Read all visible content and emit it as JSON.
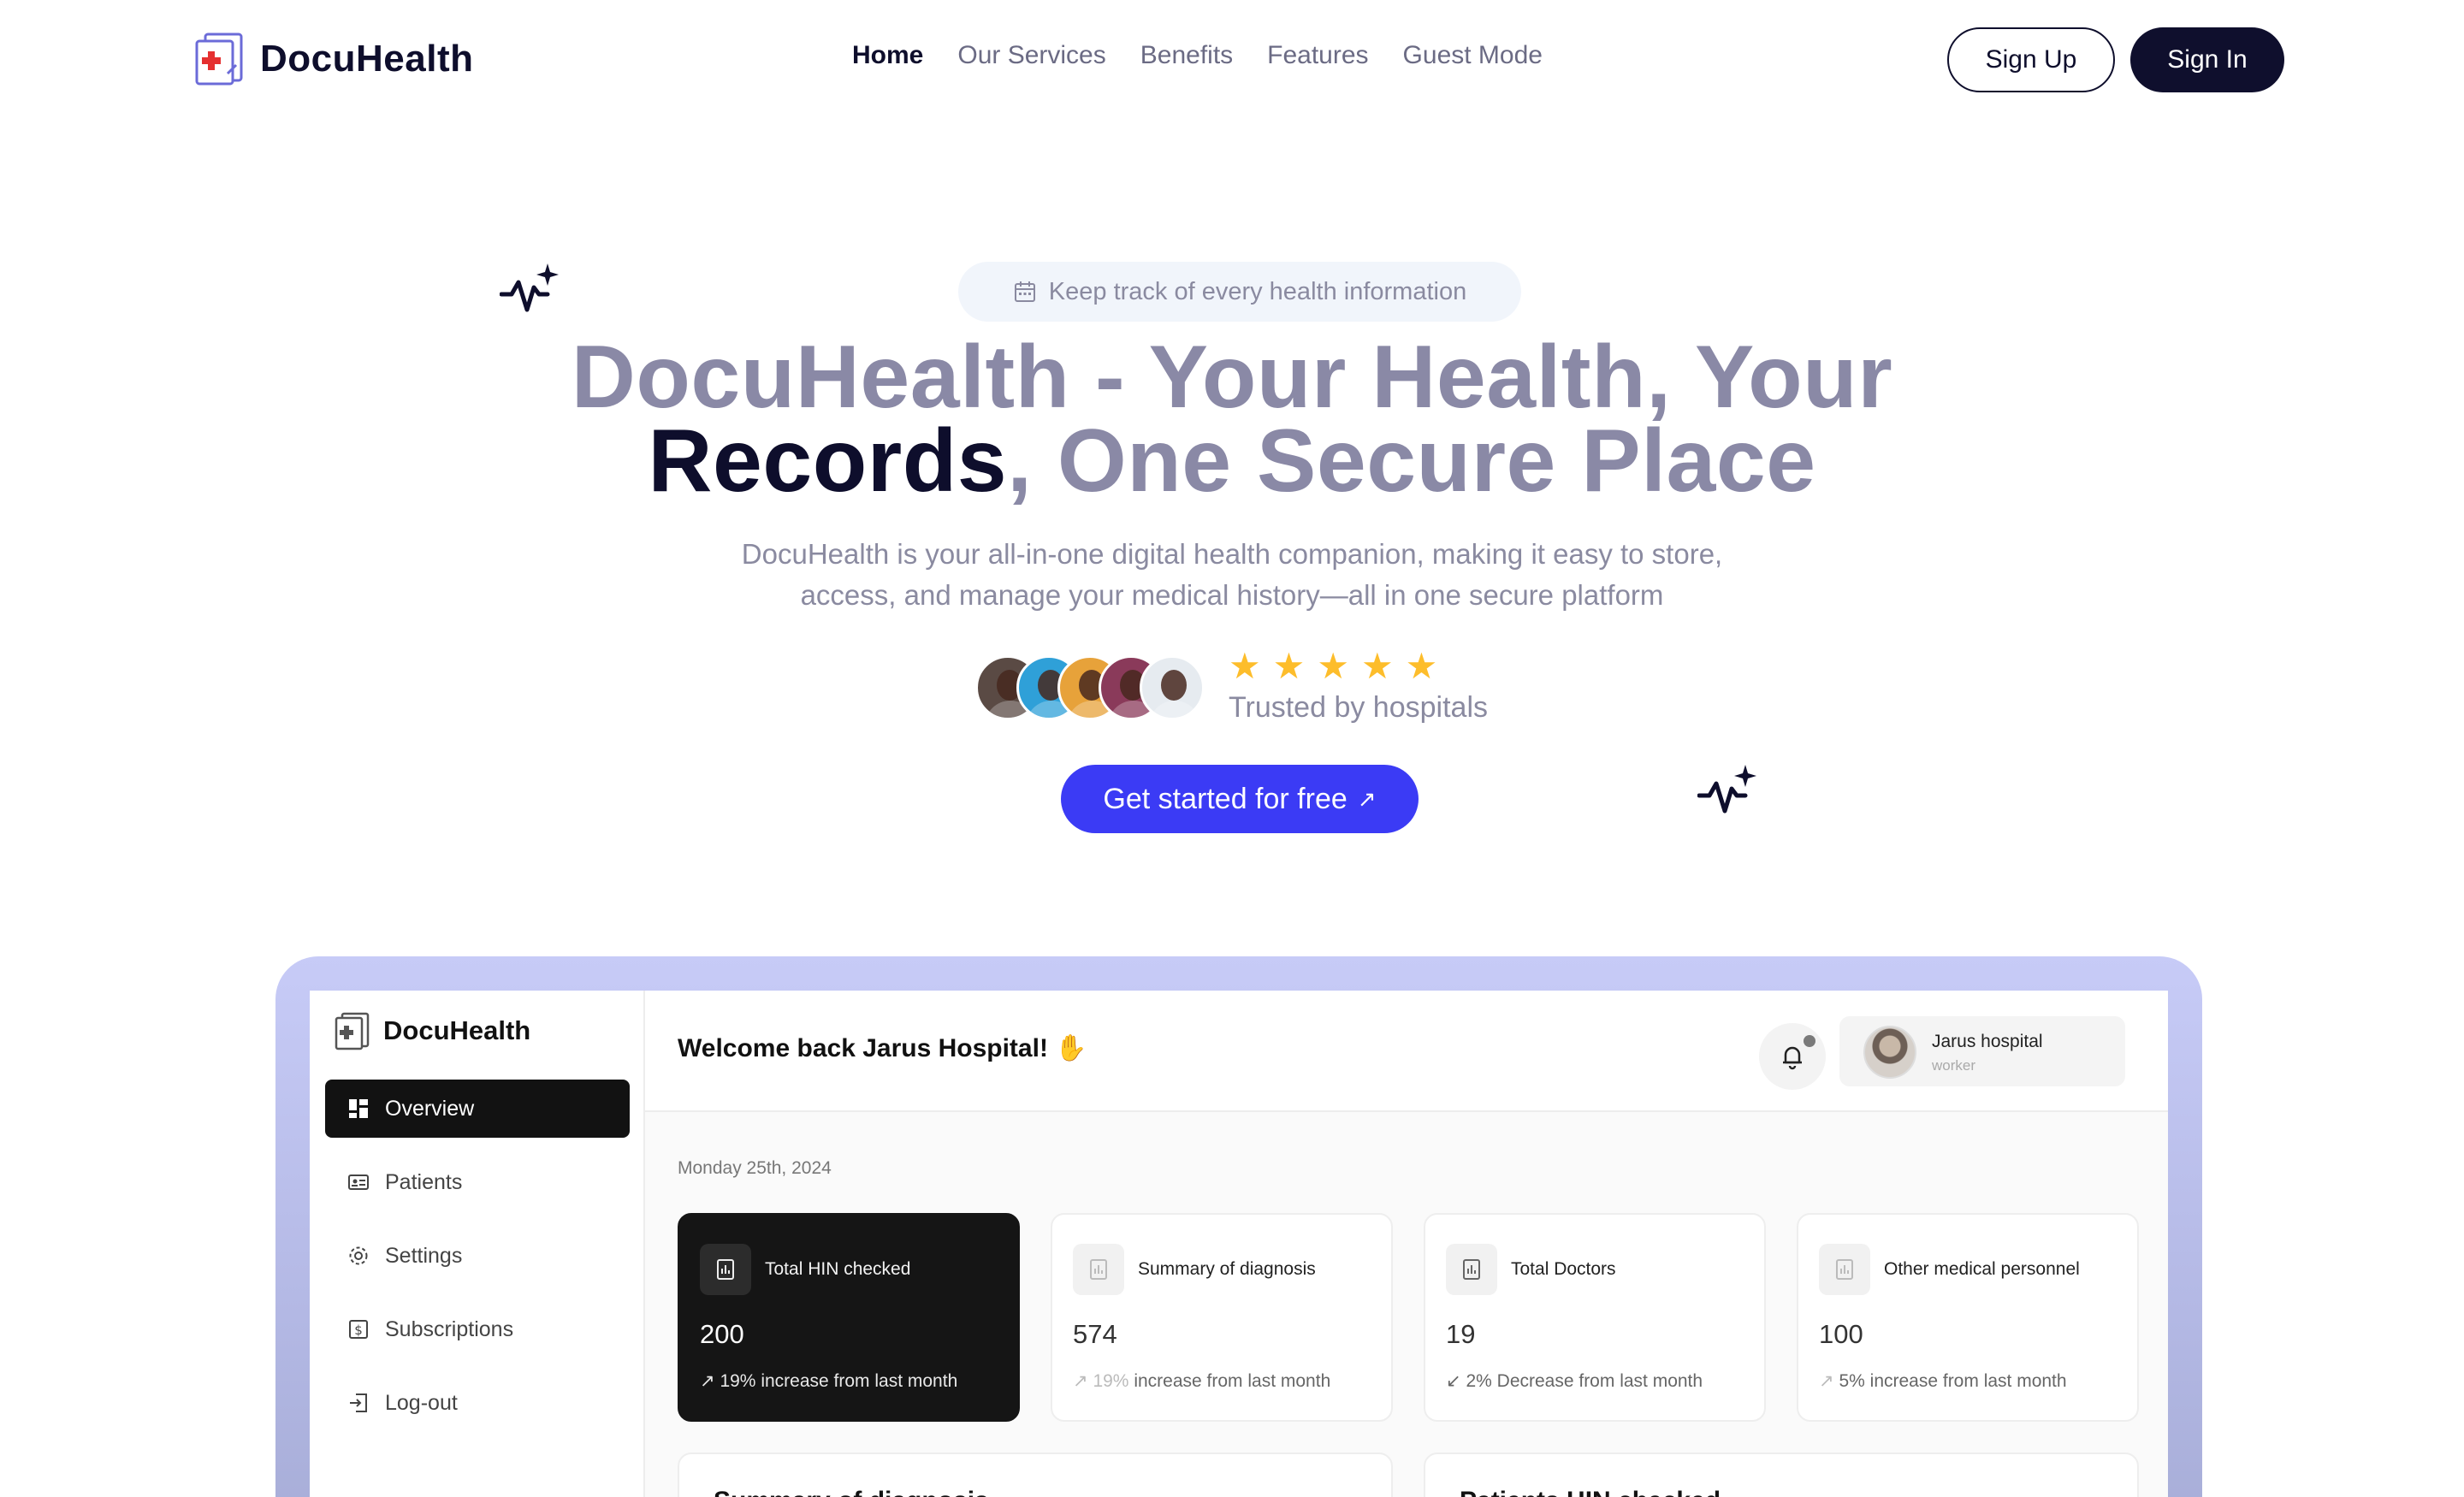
{
  "nav": {
    "brand": "DocuHealth",
    "links": [
      "Home",
      "Our Services",
      "Benefits",
      "Features",
      "Guest Mode"
    ],
    "active_index": 0,
    "sign_up": "Sign Up",
    "sign_in": "Sign In"
  },
  "hero": {
    "pill": "Keep track of every health information",
    "title_part1": "DocuHealth - Your Health, Your",
    "title_dark": "Records",
    "title_part2": ", One Secure Place",
    "subtitle_line1": "DocuHealth is your all-in-one digital health companion, making it easy to store,",
    "subtitle_line2": "access, and manage your medical history—all in one secure platform",
    "rating_stars": 5,
    "trusted": "Trusted by hospitals",
    "cta": "Get started for free",
    "avatar_colors": [
      "#5a4a44",
      "#2fa0d8",
      "#e7a23a",
      "#8a3a5a",
      "#e6ebf0"
    ]
  },
  "dashboard": {
    "brand": "DocuHealth",
    "menu": [
      {
        "label": "Overview",
        "icon": "grid-icon",
        "active": true
      },
      {
        "label": "Patients",
        "icon": "id-card-icon",
        "active": false
      },
      {
        "label": "Settings",
        "icon": "gear-icon",
        "active": false
      },
      {
        "label": "Subscriptions",
        "icon": "dollar-icon",
        "active": false
      },
      {
        "label": "Log-out",
        "icon": "logout-icon",
        "active": false
      }
    ],
    "welcome": "Welcome back Jarus Hospital!",
    "user": {
      "name": "Jarus hospital",
      "role": "worker"
    },
    "date": "Monday 25th, 2024",
    "cards": [
      {
        "title": "Total HIN checked",
        "value": "200",
        "arrow": "↗",
        "trend_pct": "19%",
        "trend_text": " increase from last month"
      },
      {
        "title": "Summary of diagnosis",
        "value": "574",
        "arrow": "↗",
        "trend_pct": "19%",
        "trend_text": " increase from last month"
      },
      {
        "title": "Total Doctors",
        "value": "19",
        "arrow": "↙",
        "trend_pct": "2%",
        "trend_text": " Decrease from last month"
      },
      {
        "title": "Other medical personnel",
        "value": "100",
        "arrow": "↗",
        "trend_pct": "5%",
        "trend_text": " increase from last month"
      }
    ],
    "panels": [
      "Summary of diagnosis",
      "Patients HIN checked"
    ]
  },
  "colors": {
    "brand_dark": "#0e0e2c",
    "cta_blue": "#3b3bf5",
    "star": "#fdbd2b",
    "muted_text": "#8a8aa0"
  }
}
